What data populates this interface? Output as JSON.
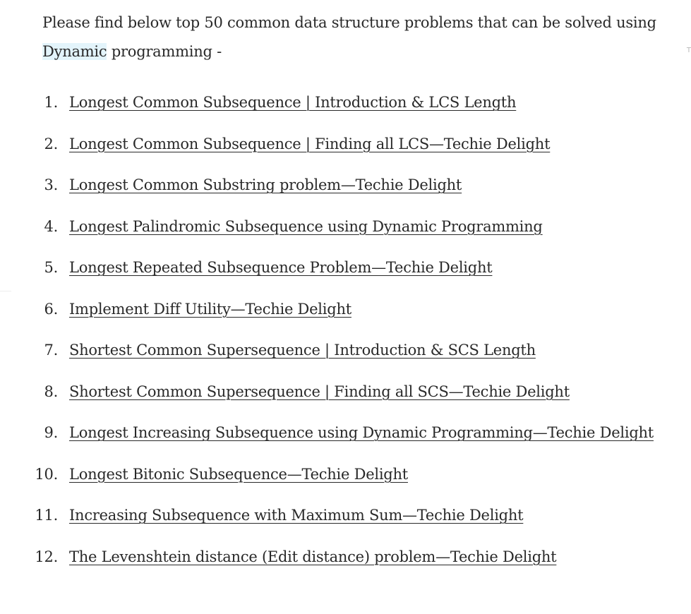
{
  "intro": {
    "before": "Please find below top 50 common data structure problems that can be solved using ",
    "highlight": "Dynamic",
    "after": " programming -"
  },
  "side_marker": "T",
  "problems": [
    {
      "number": "1.",
      "title": "Longest Common Subsequence | Introduction & LCS Length"
    },
    {
      "number": "2.",
      "title": "Longest Common Subsequence | Finding all LCS—Techie Delight"
    },
    {
      "number": "3.",
      "title": "Longest Common Substring problem—Techie Delight"
    },
    {
      "number": "4.",
      "title": "Longest Palindromic Subsequence using Dynamic Programming"
    },
    {
      "number": "5.",
      "title": "Longest Repeated Subsequence Problem—Techie Delight"
    },
    {
      "number": "6.",
      "title": "Implement Diff Utility—Techie Delight"
    },
    {
      "number": "7.",
      "title": "Shortest Common Supersequence | Introduction & SCS Length"
    },
    {
      "number": "8.",
      "title": "Shortest Common Supersequence | Finding all SCS—Techie Delight"
    },
    {
      "number": "9.",
      "title": "Longest Increasing Subsequence using Dynamic Programming—Techie Delight"
    },
    {
      "number": "10.",
      "title": "Longest Bitonic Subsequence—Techie Delight"
    },
    {
      "number": "11.",
      "title": "Increasing Subsequence with Maximum Sum—Techie Delight"
    },
    {
      "number": "12.",
      "title": "The Levenshtein distance (Edit distance) problem—Techie Delight"
    }
  ]
}
